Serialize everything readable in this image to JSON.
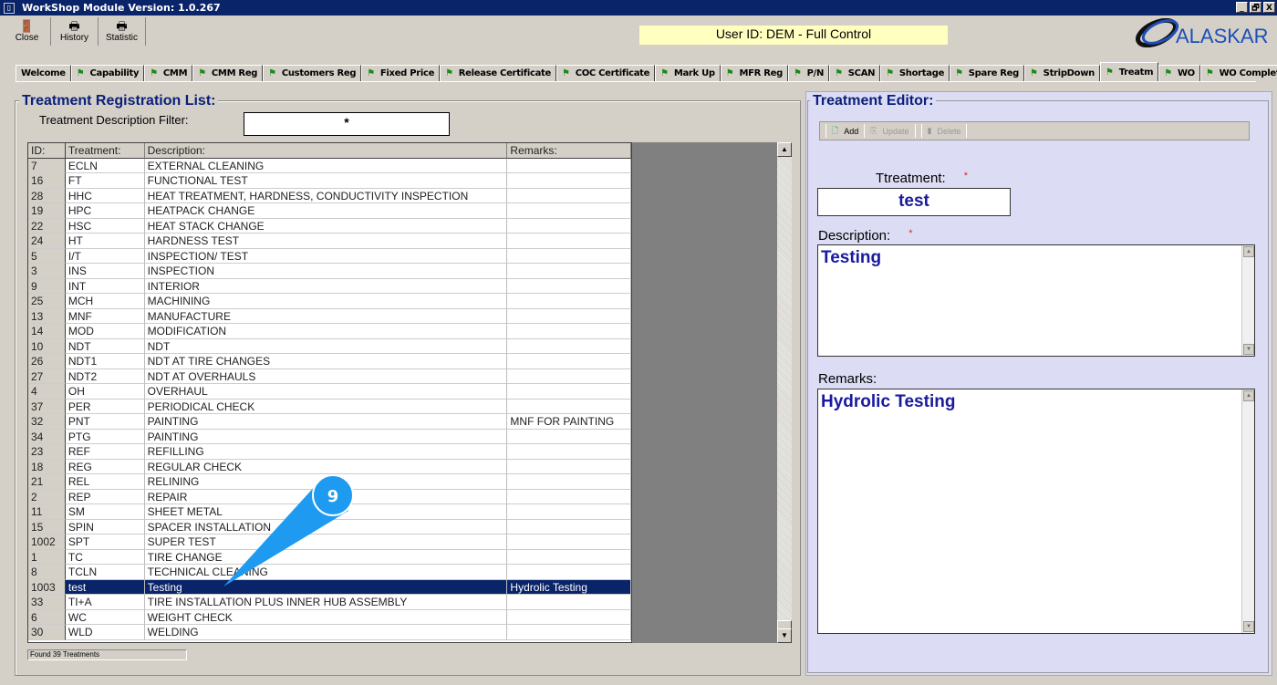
{
  "window": {
    "title": "WorkShop Module  Version: 1.0.267",
    "controls": [
      "_",
      "🗗",
      "X"
    ]
  },
  "toolbar": [
    {
      "label": "Close",
      "icon": "exit-door-icon"
    },
    {
      "label": "History",
      "icon": "printer-icon"
    },
    {
      "label": "Statistic",
      "icon": "printer-icon"
    }
  ],
  "user_banner": "User ID: DEM - Full Control",
  "logo_text": "ALASKAR",
  "tabs": [
    "Welcome",
    "Capability",
    "CMM",
    "CMM Reg",
    "Customers Reg",
    "Fixed Price",
    "Release Certificate",
    "COC Certificate",
    "Mark Up",
    "MFR Reg",
    "P/N",
    "SCAN",
    "Shortage",
    "Spare Reg",
    "StripDown",
    "Treatm",
    "WO",
    "WO Completion"
  ],
  "active_tab": "Treatm",
  "list": {
    "title": "Treatment Registration List:",
    "filter_label": "Treatment Description Filter:",
    "filter_value": "*",
    "columns": [
      "ID:",
      "Treatment:",
      "Description:",
      "Remarks:"
    ],
    "rows": [
      [
        "7",
        "ECLN",
        "EXTERNAL CLEANING",
        ""
      ],
      [
        "16",
        "FT",
        "FUNCTIONAL TEST",
        ""
      ],
      [
        "28",
        "HHC",
        "HEAT TREATMENT, HARDNESS, CONDUCTIVITY INSPECTION",
        ""
      ],
      [
        "19",
        "HPC",
        "HEATPACK CHANGE",
        ""
      ],
      [
        "22",
        "HSC",
        "HEAT STACK CHANGE",
        ""
      ],
      [
        "24",
        "HT",
        "HARDNESS TEST",
        ""
      ],
      [
        "5",
        "I/T",
        "INSPECTION/ TEST",
        ""
      ],
      [
        "3",
        "INS",
        "INSPECTION",
        ""
      ],
      [
        "9",
        "INT",
        "INTERIOR",
        ""
      ],
      [
        "25",
        "MCH",
        "MACHINING",
        ""
      ],
      [
        "13",
        "MNF",
        "MANUFACTURE",
        ""
      ],
      [
        "14",
        "MOD",
        "MODIFICATION",
        ""
      ],
      [
        "10",
        "NDT",
        "NDT",
        ""
      ],
      [
        "26",
        "NDT1",
        "NDT AT TIRE CHANGES",
        ""
      ],
      [
        "27",
        "NDT2",
        "NDT AT OVERHAULS",
        ""
      ],
      [
        "4",
        "OH",
        "OVERHAUL",
        ""
      ],
      [
        "37",
        "PER",
        "PERIODICAL CHECK",
        ""
      ],
      [
        "32",
        "PNT",
        "PAINTING",
        "MNF FOR PAINTING"
      ],
      [
        "34",
        "PTG",
        "PAINTING",
        ""
      ],
      [
        "23",
        "REF",
        "REFILLING",
        ""
      ],
      [
        "18",
        "REG",
        "REGULAR CHECK",
        ""
      ],
      [
        "21",
        "REL",
        "RELINING",
        ""
      ],
      [
        "2",
        "REP",
        "REPAIR",
        ""
      ],
      [
        "11",
        "SM",
        "SHEET METAL",
        ""
      ],
      [
        "15",
        "SPIN",
        "SPACER INSTALLATION",
        ""
      ],
      [
        "1002",
        "SPT",
        "SUPER TEST",
        ""
      ],
      [
        "1",
        "TC",
        "TIRE CHANGE",
        ""
      ],
      [
        "8",
        "TCLN",
        "TECHNICAL CLEANING",
        ""
      ],
      [
        "1003",
        "test",
        "Testing",
        "Hydrolic Testing"
      ],
      [
        "33",
        "TI+A",
        "TIRE INSTALLATION PLUS INNER HUB ASSEMBLY",
        ""
      ],
      [
        "6",
        "WC",
        "WEIGHT CHECK",
        ""
      ],
      [
        "30",
        "WLD",
        "WELDING",
        ""
      ]
    ],
    "selected_id": "1003",
    "status": "Found 39 Treatments"
  },
  "editor": {
    "title": "Treatment Editor:",
    "buttons": {
      "add": "Add",
      "update": "Update",
      "delete": "Delete"
    },
    "treatment_label": "Ttreatment:",
    "treatment_value": "test",
    "description_label": "Description:",
    "description_value": "Testing",
    "remarks_label": "Remarks:",
    "remarks_value": "Hydrolic Testing",
    "required_mark": "*"
  },
  "callout": {
    "number": "9",
    "color": "#1e9bf0"
  }
}
